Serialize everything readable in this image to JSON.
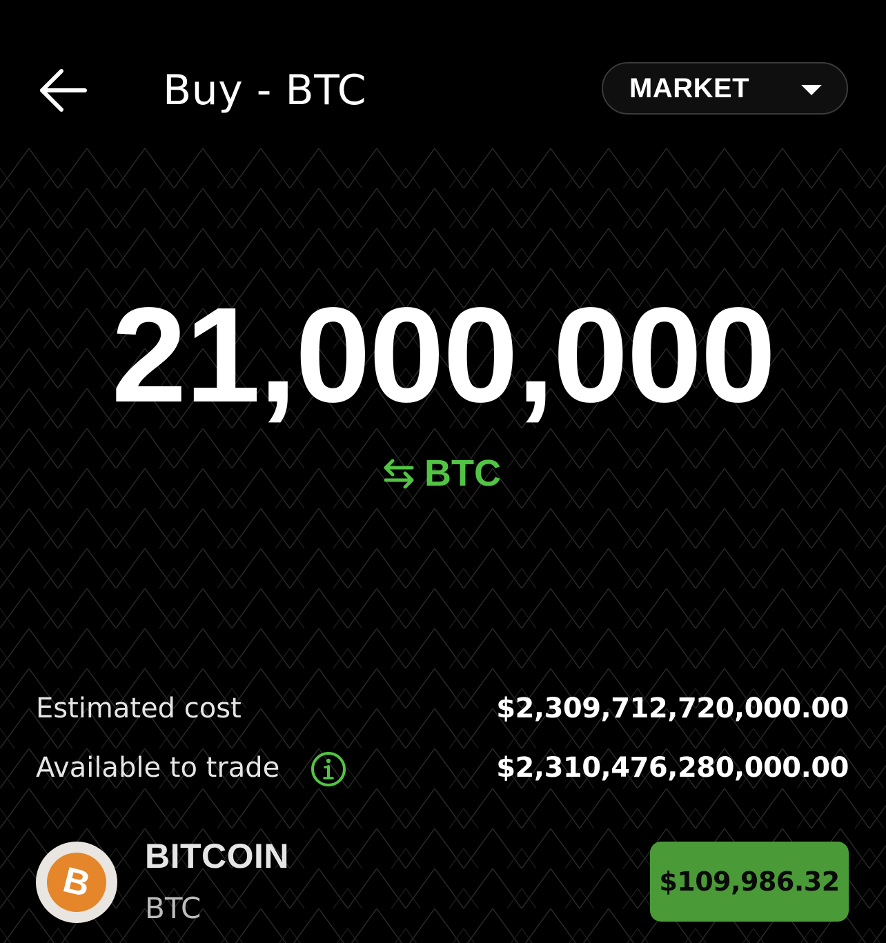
{
  "header": {
    "title": "Buy - BTC",
    "order_type": "MARKET"
  },
  "order": {
    "amount": "21,000,000",
    "unit": "BTC"
  },
  "summary": {
    "estimated_cost_label": "Estimated cost",
    "estimated_cost_value": "$2,309,712,720,000.00",
    "available_label": "Available to trade",
    "available_value": "$2,310,476,280,000.00"
  },
  "asset": {
    "name": "BITCOIN",
    "ticker": "BTC",
    "logo_glyph": "B",
    "price": "$109,986.32"
  },
  "colors": {
    "background": "#000000",
    "accent_green": "#52c444",
    "button_green": "#4b9a38",
    "bitcoin_orange": "#e5862a"
  },
  "icons": {
    "back": "arrow-left-icon",
    "dropdown": "caret-down-icon",
    "swap": "swap-arrows-icon",
    "info": "info-icon",
    "coin": "bitcoin-logo-icon"
  }
}
